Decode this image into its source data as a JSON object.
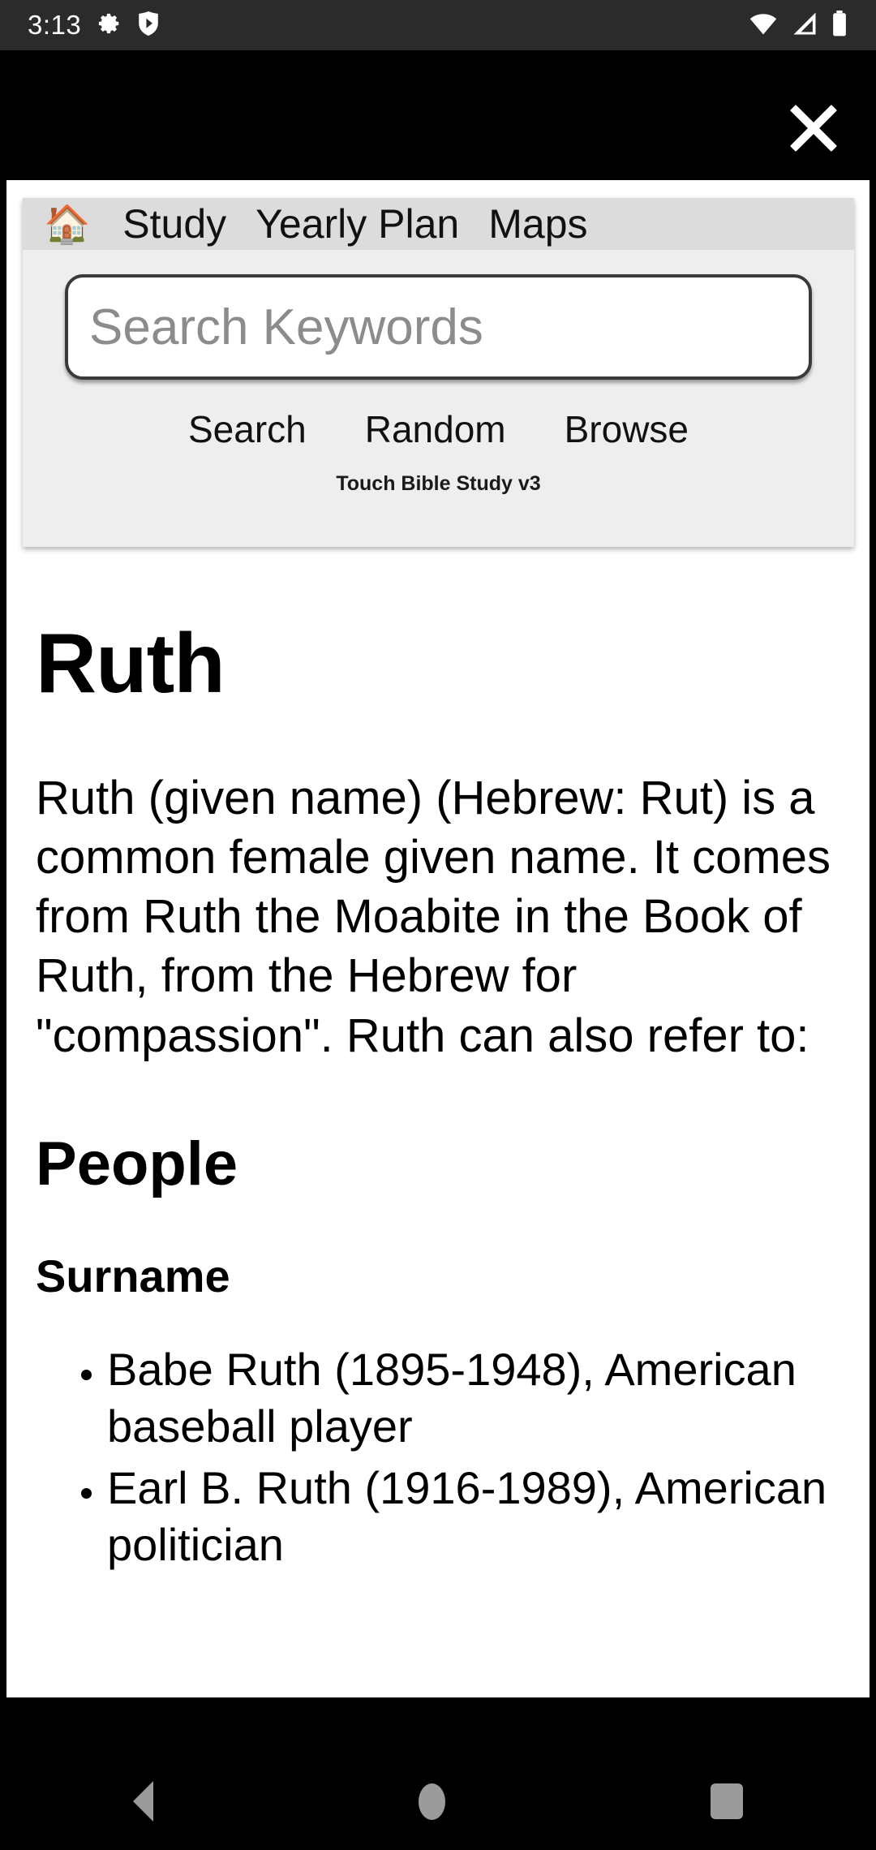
{
  "status_bar": {
    "time": "3:13",
    "left_icons": [
      "gear-icon",
      "play-protect-icon"
    ],
    "right_icons": [
      "wifi-icon",
      "cellular-signal-icon",
      "battery-icon"
    ]
  },
  "overlay": {
    "close_label": "✕"
  },
  "header": {
    "home_icon": "🏠",
    "nav_links": [
      "Study",
      "Yearly Plan",
      "Maps"
    ],
    "search": {
      "value": "",
      "placeholder": "Search Keywords"
    },
    "actions": [
      "Search",
      "Random",
      "Browse"
    ],
    "app_version": "Touch Bible Study v3"
  },
  "article": {
    "title": "Ruth",
    "lead": "Ruth (given name) (Hebrew: Rut) is a common female given name. It comes from Ruth the Moabite in the Book of Ruth, from the Hebrew for \"compassion\". Ruth can also refer to:",
    "section_heading": "People",
    "subsection_heading": "Surname",
    "list_items": [
      "Babe Ruth (1895-1948), American baseball player",
      "Earl B. Ruth (1916-1989), American politician"
    ]
  },
  "system_nav": {
    "back": "back-button",
    "home": "home-button",
    "recents": "recents-button"
  },
  "colors": {
    "status_bar_bg": "#2b2b2b",
    "overlay_bg": "#000000",
    "header_card_bg": "#eeeeee",
    "nav_strip_bg": "#dcdcdc",
    "page_bg": "#ffffff",
    "text": "#000000",
    "placeholder": "#8c8c8c",
    "system_nav_icon": "#9b9b9b"
  }
}
